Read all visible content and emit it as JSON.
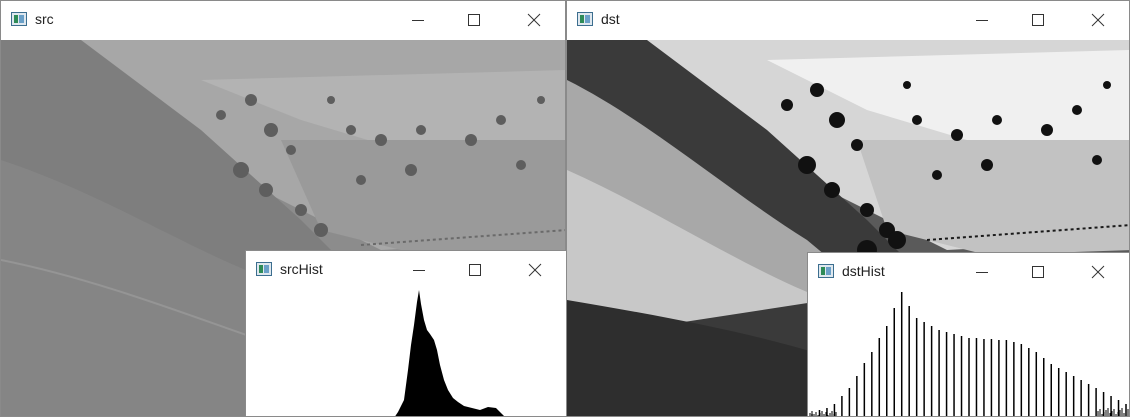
{
  "windows": {
    "src": {
      "title": "src"
    },
    "dst": {
      "title": "dst"
    },
    "srcHist": {
      "title": "srcHist"
    },
    "dstHist": {
      "title": "dstHist"
    }
  },
  "icons": {
    "app": "opencv-window-icon",
    "minimize": "minimize-icon",
    "maximize": "maximize-icon",
    "close": "close-icon"
  },
  "colors": {
    "titlebar": "#ffffff",
    "histogram_fill": "#000000",
    "histogram_bg": "#ffffff"
  }
}
